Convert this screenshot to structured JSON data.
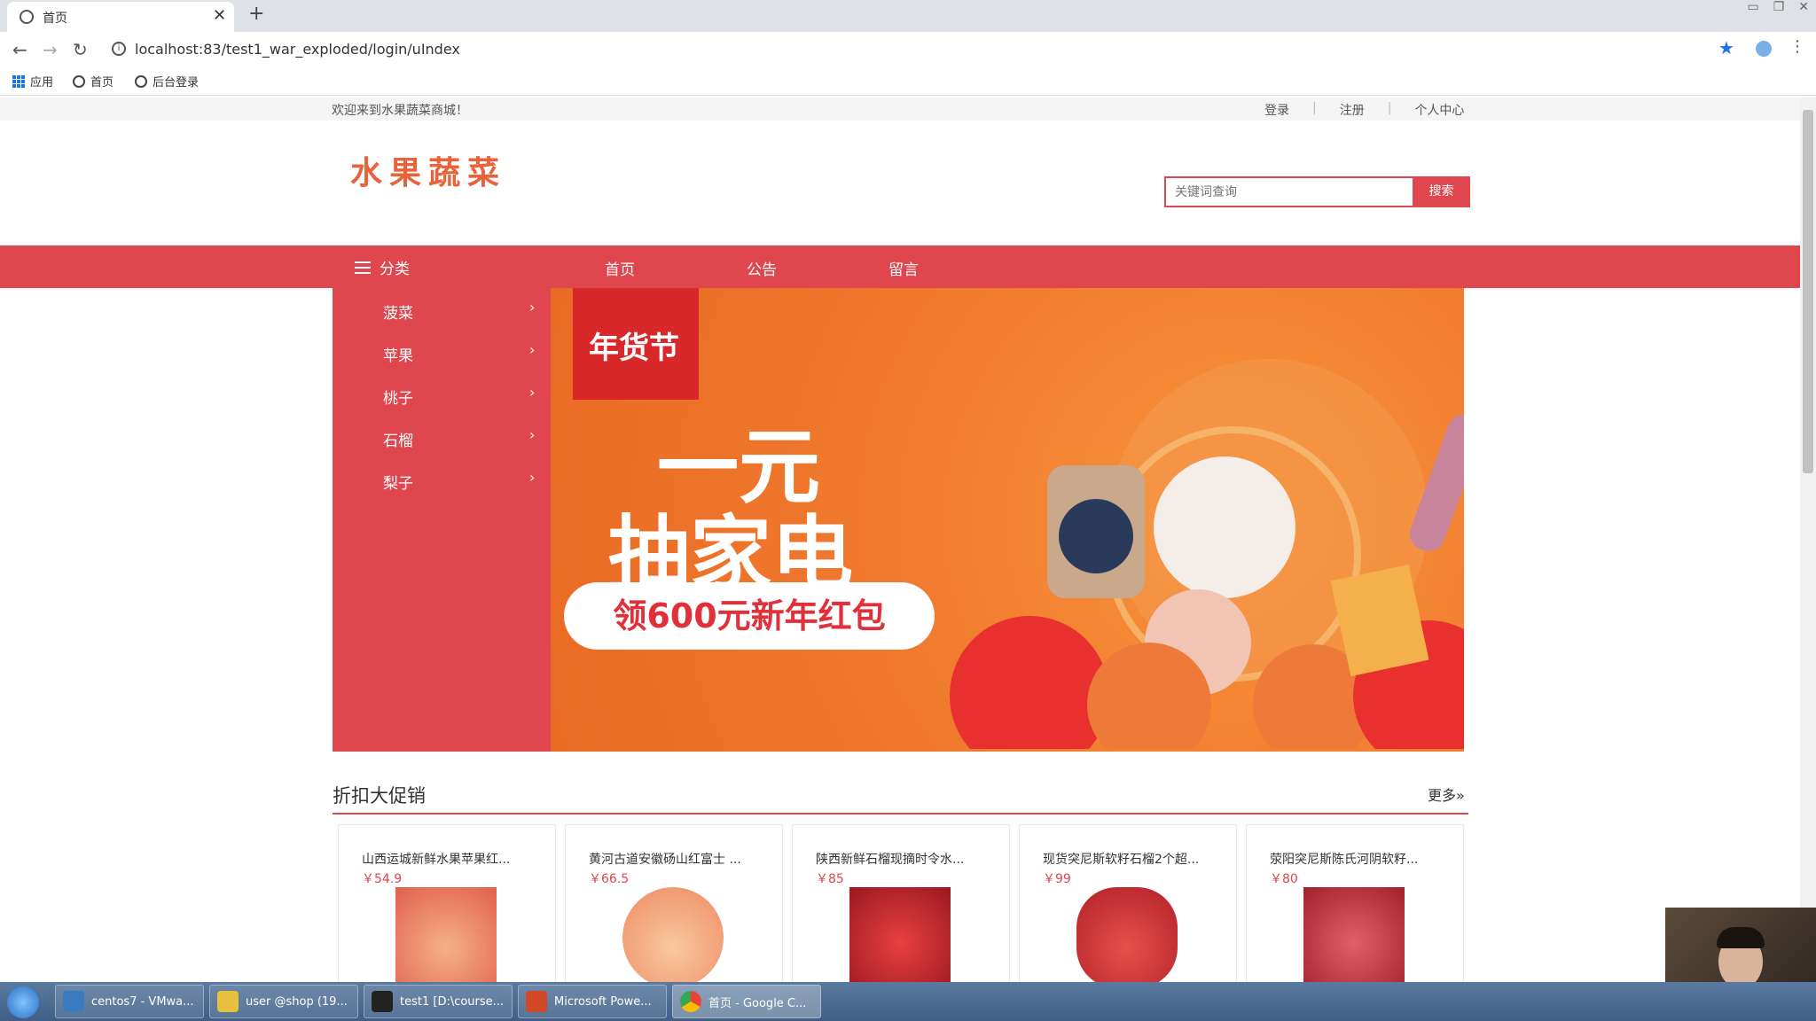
{
  "browser": {
    "tab_title": "首页",
    "url": "localhost:83/test1_war_exploded/login/uIndex",
    "bookmarks": [
      "应用",
      "首页",
      "后台登录"
    ]
  },
  "site": {
    "welcome": "欢迎来到水果蔬菜商城！",
    "top_links": [
      "登录",
      "注册",
      "个人中心"
    ],
    "logo_text": "水果蔬菜",
    "search_placeholder": "关键词查询",
    "search_button": "搜索",
    "nav": {
      "category_label": "分类",
      "links": [
        "首页",
        "公告",
        "留言"
      ]
    },
    "categories": [
      "菠菜",
      "苹果",
      "桃子",
      "石榴",
      "梨子"
    ],
    "banner": {
      "badge": "年货节",
      "line1": "一元",
      "line2": "抽家电",
      "pill": "领600元新年红包"
    },
    "section": {
      "title": "折扣大促销",
      "more": "更多»",
      "products": [
        {
          "name": "山西运城新鲜水果苹果红...",
          "price": "￥54.9",
          "img_color": "#f08a6a"
        },
        {
          "name": "黄河古道安徽砀山红富士 ...",
          "price": "￥66.5",
          "img_color": "#f2a07a"
        },
        {
          "name": "陕西新鲜石榴现摘时令水...",
          "price": "￥85",
          "img_color": "#c8232c"
        },
        {
          "name": "现货突尼斯软籽石榴2个超...",
          "price": "￥99",
          "img_color": "#d0302a"
        },
        {
          "name": "荥阳突尼斯陈氏河阴软籽...",
          "price": "￥80",
          "img_color": "#b8283a"
        }
      ]
    }
  },
  "taskbar": {
    "items": [
      "centos7 - VMwa...",
      "user @shop (19...",
      "test1 [D:\\course...",
      "Microsoft Powe...",
      "首页 - Google C..."
    ]
  },
  "colors": {
    "brand_red": "#e0464e",
    "banner_orange": "#f07a2e"
  }
}
